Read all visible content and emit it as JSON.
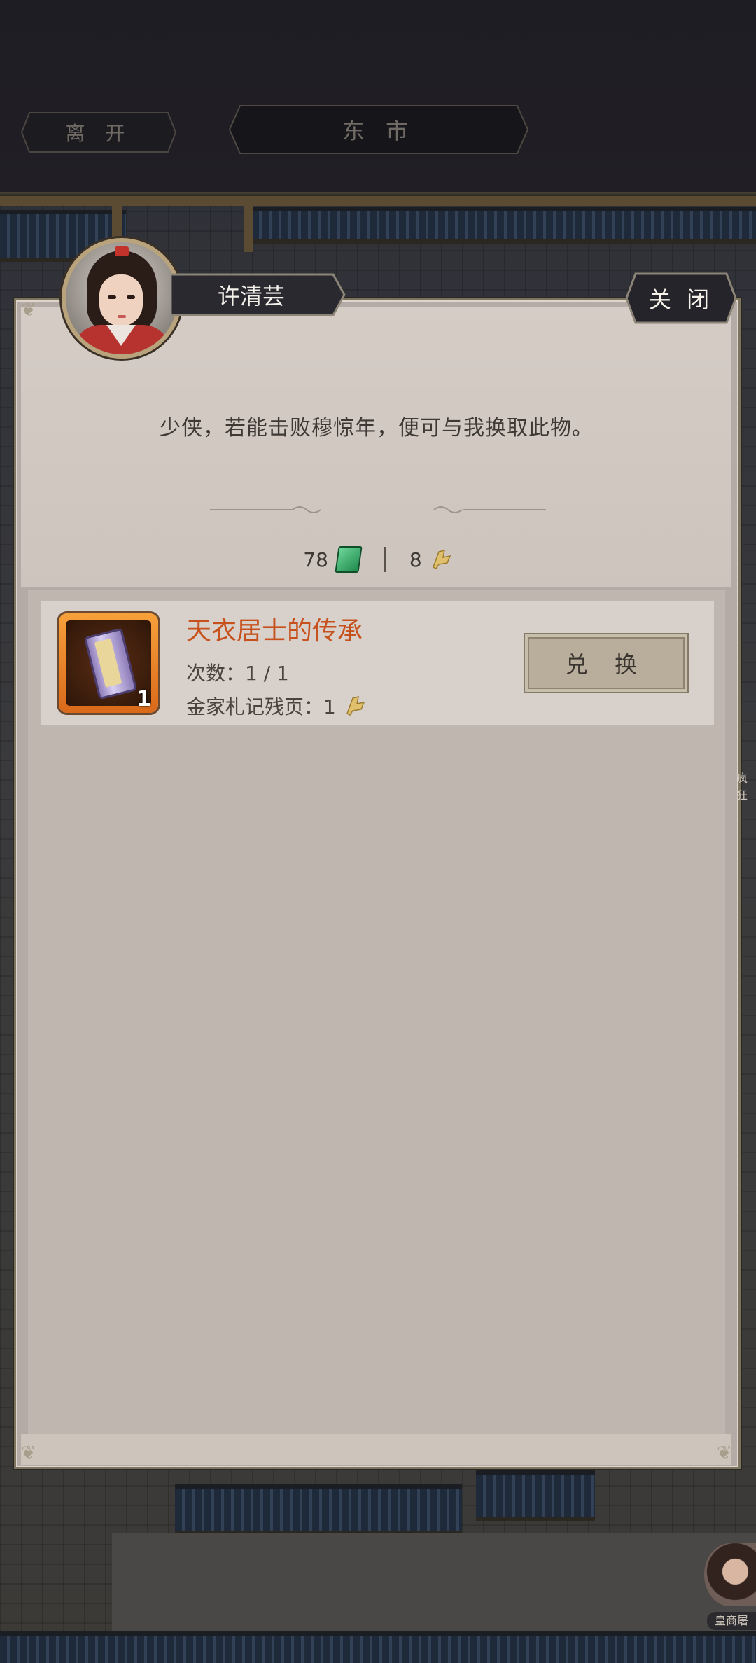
{
  "top_bar": {
    "leave_label": "离 开",
    "location_label": "东 市"
  },
  "dialog": {
    "npc_name": "许清芸",
    "close_label": "关 闭",
    "npc_text": "少侠，若能击败穆惊年，便可与我换取此物。"
  },
  "currency": {
    "jade_amount": "78",
    "slip_amount": "8"
  },
  "items": [
    {
      "name": "天衣居士的传承",
      "count_badge": "1",
      "times_text": "次数：1 / 1",
      "cost_text": "金家札记残页：1",
      "exchange_label": "兑 换"
    }
  ],
  "side": {
    "portrait_label": "皇商屠",
    "edge_text": "疯狂"
  },
  "colors": {
    "item_name": "#c7511c",
    "dialog_bg": "#b5aba6",
    "topbar_bg": "#1e1d23"
  }
}
